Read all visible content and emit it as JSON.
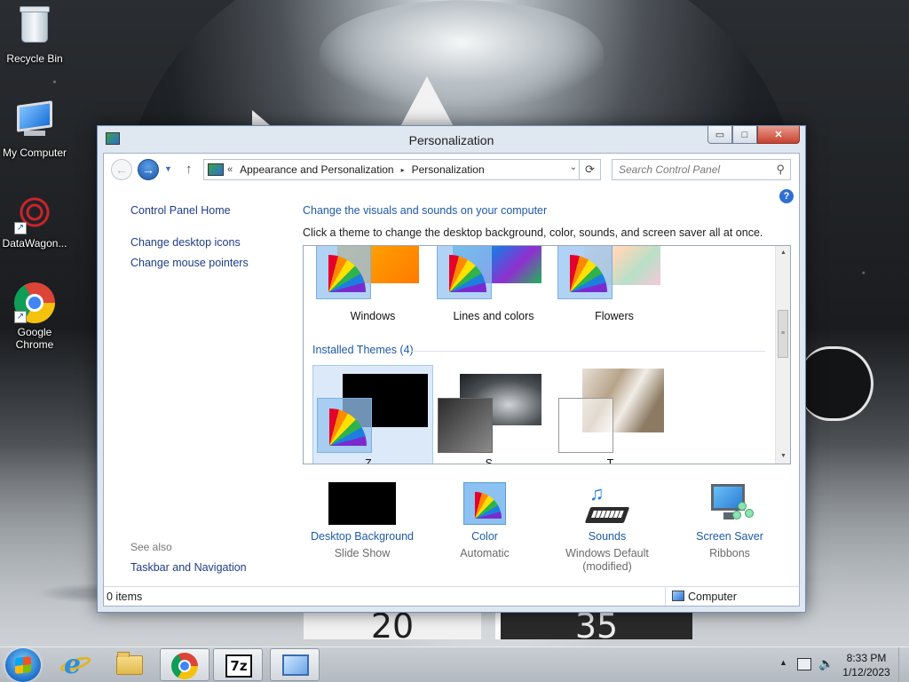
{
  "desktop": {
    "icons": [
      {
        "label": "Recycle Bin",
        "icon": "recycle-bin-icon"
      },
      {
        "label": "My Computer",
        "icon": "computer-icon"
      },
      {
        "label": "DataWagon...",
        "icon": "datawagon-icon"
      },
      {
        "label": "Google\nChrome",
        "icon": "chrome-icon"
      }
    ],
    "wallpaper_clock": {
      "left": "20",
      "right": "35"
    }
  },
  "window": {
    "title": "Personalization",
    "caption_buttons": {
      "minimize": "▭",
      "maximize": "□",
      "close": "✕"
    },
    "nav": {
      "back_glyph": "←",
      "forward_glyph": "→",
      "up_glyph": "↑",
      "breadcrumb_prefix": "«",
      "breadcrumbs": [
        "Appearance and Personalization",
        "Personalization"
      ],
      "breadcrumb_separator": "▸",
      "refresh_glyph": "⟳"
    },
    "search": {
      "placeholder": "Search Control Panel"
    },
    "help_glyph": "?",
    "left_pane": {
      "home_link": "Control Panel Home",
      "links": [
        "Change desktop icons",
        "Change mouse pointers"
      ],
      "see_also_label": "See also",
      "see_also_links": [
        "Taskbar and Navigation"
      ]
    },
    "main": {
      "heading": "Change the visuals and sounds on your computer",
      "subheading": "Click a theme to change the desktop background, color, sounds, and screen saver all at once."
    },
    "themes": {
      "default_themes": [
        {
          "name": "Windows"
        },
        {
          "name": "Lines and colors"
        },
        {
          "name": "Flowers"
        }
      ],
      "installed_group_label": "Installed Themes (4)",
      "installed_themes": [
        {
          "name": "Z..."
        },
        {
          "name": "S..."
        },
        {
          "name": "T..."
        }
      ]
    },
    "settings": [
      {
        "label": "Desktop Background",
        "value": "Slide Show",
        "icon": "desktop-background-icon"
      },
      {
        "label": "Color",
        "value": "Automatic",
        "icon": "color-palette-icon"
      },
      {
        "label": "Sounds",
        "value": "Windows Default\n(modified)",
        "icon": "sounds-icon"
      },
      {
        "label": "Screen Saver",
        "value": "Ribbons",
        "icon": "screen-saver-icon"
      }
    ],
    "status": {
      "items": "0 items",
      "location": "Computer"
    }
  },
  "taskbar": {
    "pinned": [
      "start-button",
      "internet-explorer",
      "file-explorer",
      "google-chrome",
      "7-zip",
      "control-panel"
    ],
    "time": "8:33 PM",
    "date": "1/12/2023"
  },
  "colors": {
    "link_blue": "#1e5aa8",
    "window_frame": "#dfe7f1",
    "close_red": "#c7422e"
  }
}
